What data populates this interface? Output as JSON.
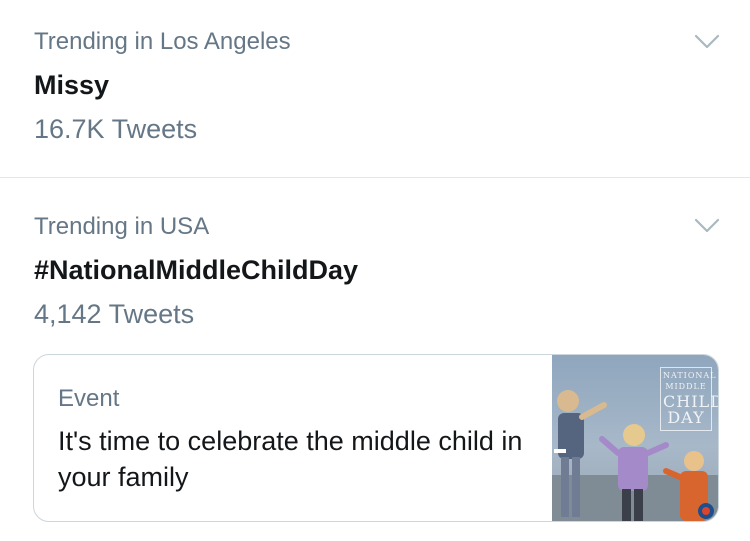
{
  "trends": [
    {
      "context": "Trending in Los Angeles",
      "name": "Missy",
      "count": "16.7K Tweets"
    },
    {
      "context": "Trending in USA",
      "name": "#NationalMiddleChildDay",
      "count": "4,142 Tweets",
      "event": {
        "kind": "Event",
        "title": "It's time to celebrate the middle child in your family",
        "image_overlay": {
          "line1": "NATIONAL",
          "line2": "MIDDLE",
          "line3": "CHILD",
          "line4": "DAY"
        }
      }
    }
  ],
  "icons": {
    "more": "chevron-down-icon"
  },
  "colors": {
    "primary_text": "#14171a",
    "secondary_text": "#657786",
    "divider": "#e1e8ed"
  }
}
